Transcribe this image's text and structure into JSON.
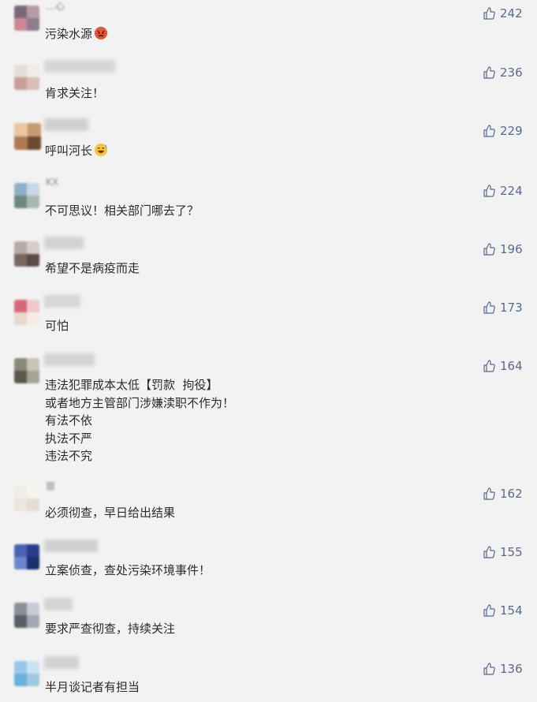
{
  "comments": [
    {
      "nickname": "…心",
      "lines": [
        "污染水源"
      ],
      "emoji": "angry-face",
      "likes": "242"
    },
    {
      "nickname": "",
      "lines": [
        "肯求关注！"
      ],
      "likes": "236"
    },
    {
      "nickname": "",
      "lines": [
        "呼叫河长"
      ],
      "emoji": "grinning-sweat-face",
      "likes": "229"
    },
    {
      "nickname": "KX",
      "lines": [
        "不可思议！相关部门哪去了？"
      ],
      "likes": "224"
    },
    {
      "nickname": "",
      "lines": [
        "希望不是病疫而走"
      ],
      "likes": "196"
    },
    {
      "nickname": "",
      "lines": [
        "可怕"
      ],
      "likes": "173"
    },
    {
      "nickname": "",
      "lines": [
        "违法犯罪成本太低【罚款  拘役】",
        "或者地方主管部门涉嫌渎职不作为！",
        "有法不依",
        "执法不严",
        "违法不究"
      ],
      "likes": "164"
    },
    {
      "nickname": "罪",
      "lines": [
        "必须彻查，早日给出结果"
      ],
      "likes": "162"
    },
    {
      "nickname": "",
      "lines": [
        "立案侦查，查处污染环境事件！"
      ],
      "likes": "155"
    },
    {
      "nickname": "",
      "lines": [
        "要求严查彻查，持续关注"
      ],
      "likes": "154"
    },
    {
      "nickname": "",
      "lines": [
        "半月谈记者有担当"
      ],
      "likes": "136"
    }
  ],
  "colors": {
    "background": "#f2f2f2",
    "text": "#2b2b2b",
    "like": "#586a8c"
  },
  "icons": {
    "like": "thumbs-up-icon"
  }
}
